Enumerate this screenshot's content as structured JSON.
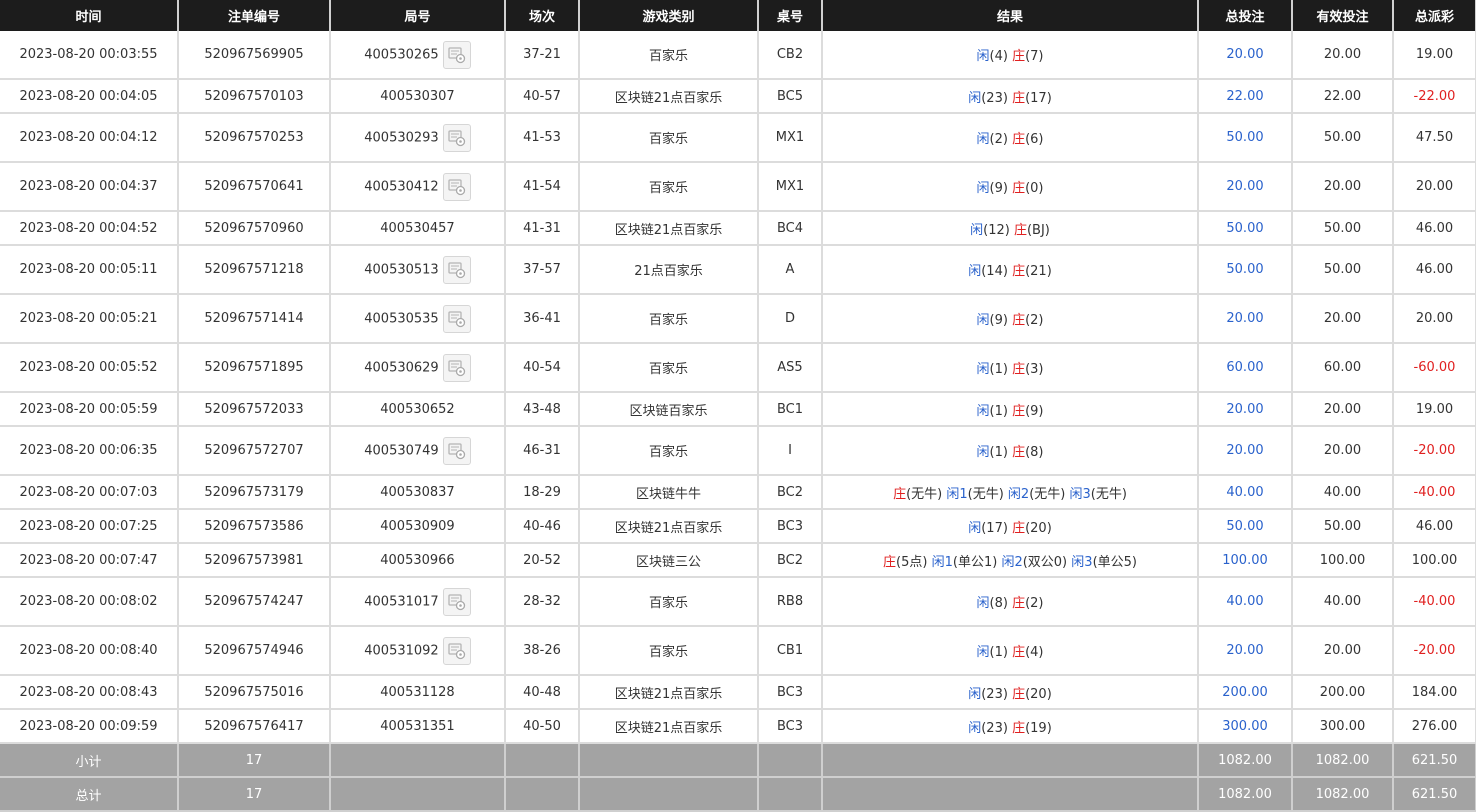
{
  "headers": [
    "时间",
    "注单编号",
    "局号",
    "场次",
    "游戏类别",
    "桌号",
    "结果",
    "总投注",
    "有效投注",
    "总派彩"
  ],
  "colors": {
    "header_bg": "#1c1c1c",
    "footer_bg": "#a3a3a3",
    "blue": "#2a62cc",
    "red": "#e02020"
  },
  "rows": [
    {
      "time": "2023-08-20 00:03:55",
      "order": "520967569905",
      "round": "400530265",
      "has_icon": true,
      "session": "37-21",
      "game": "百家乐",
      "table": "CB2",
      "result": [
        {
          "t": "闲",
          "c": "x"
        },
        {
          "t": "(4) ",
          "c": "g"
        },
        {
          "t": "庄",
          "c": "z"
        },
        {
          "t": "(7)",
          "c": "g"
        }
      ],
      "bet": "20.00",
      "valid": "20.00",
      "payout": "19.00",
      "neg": false
    },
    {
      "time": "2023-08-20 00:04:05",
      "order": "520967570103",
      "round": "400530307",
      "has_icon": false,
      "session": "40-57",
      "game": "区块链21点百家乐",
      "table": "BC5",
      "result": [
        {
          "t": "闲",
          "c": "x"
        },
        {
          "t": "(23) ",
          "c": "g"
        },
        {
          "t": "庄",
          "c": "z"
        },
        {
          "t": "(17)",
          "c": "g"
        }
      ],
      "bet": "22.00",
      "valid": "22.00",
      "payout": "-22.00",
      "neg": true
    },
    {
      "time": "2023-08-20 00:04:12",
      "order": "520967570253",
      "round": "400530293",
      "has_icon": true,
      "session": "41-53",
      "game": "百家乐",
      "table": "MX1",
      "result": [
        {
          "t": "闲",
          "c": "x"
        },
        {
          "t": "(2) ",
          "c": "g"
        },
        {
          "t": "庄",
          "c": "z"
        },
        {
          "t": "(6)",
          "c": "g"
        }
      ],
      "bet": "50.00",
      "valid": "50.00",
      "payout": "47.50",
      "neg": false
    },
    {
      "time": "2023-08-20 00:04:37",
      "order": "520967570641",
      "round": "400530412",
      "has_icon": true,
      "session": "41-54",
      "game": "百家乐",
      "table": "MX1",
      "result": [
        {
          "t": "闲",
          "c": "x"
        },
        {
          "t": "(9) ",
          "c": "g"
        },
        {
          "t": "庄",
          "c": "z"
        },
        {
          "t": "(0)",
          "c": "g"
        }
      ],
      "bet": "20.00",
      "valid": "20.00",
      "payout": "20.00",
      "neg": false
    },
    {
      "time": "2023-08-20 00:04:52",
      "order": "520967570960",
      "round": "400530457",
      "has_icon": false,
      "session": "41-31",
      "game": "区块链21点百家乐",
      "table": "BC4",
      "result": [
        {
          "t": "闲",
          "c": "x"
        },
        {
          "t": "(12) ",
          "c": "g"
        },
        {
          "t": "庄",
          "c": "z"
        },
        {
          "t": "(BJ)",
          "c": "g"
        }
      ],
      "bet": "50.00",
      "valid": "50.00",
      "payout": "46.00",
      "neg": false
    },
    {
      "time": "2023-08-20 00:05:11",
      "order": "520967571218",
      "round": "400530513",
      "has_icon": true,
      "session": "37-57",
      "game": "21点百家乐",
      "table": "A",
      "result": [
        {
          "t": "闲",
          "c": "x"
        },
        {
          "t": "(14) ",
          "c": "g"
        },
        {
          "t": "庄",
          "c": "z"
        },
        {
          "t": "(21)",
          "c": "g"
        }
      ],
      "bet": "50.00",
      "valid": "50.00",
      "payout": "46.00",
      "neg": false
    },
    {
      "time": "2023-08-20 00:05:21",
      "order": "520967571414",
      "round": "400530535",
      "has_icon": true,
      "session": "36-41",
      "game": "百家乐",
      "table": "D",
      "result": [
        {
          "t": "闲",
          "c": "x"
        },
        {
          "t": "(9) ",
          "c": "g"
        },
        {
          "t": "庄",
          "c": "z"
        },
        {
          "t": "(2)",
          "c": "g"
        }
      ],
      "bet": "20.00",
      "valid": "20.00",
      "payout": "20.00",
      "neg": false
    },
    {
      "time": "2023-08-20 00:05:52",
      "order": "520967571895",
      "round": "400530629",
      "has_icon": true,
      "session": "40-54",
      "game": "百家乐",
      "table": "AS5",
      "result": [
        {
          "t": "闲",
          "c": "x"
        },
        {
          "t": "(1) ",
          "c": "g"
        },
        {
          "t": "庄",
          "c": "z"
        },
        {
          "t": "(3)",
          "c": "g"
        }
      ],
      "bet": "60.00",
      "valid": "60.00",
      "payout": "-60.00",
      "neg": true
    },
    {
      "time": "2023-08-20 00:05:59",
      "order": "520967572033",
      "round": "400530652",
      "has_icon": false,
      "session": "43-48",
      "game": "区块链百家乐",
      "table": "BC1",
      "result": [
        {
          "t": "闲",
          "c": "x"
        },
        {
          "t": "(1) ",
          "c": "g"
        },
        {
          "t": "庄",
          "c": "z"
        },
        {
          "t": "(9)",
          "c": "g"
        }
      ],
      "bet": "20.00",
      "valid": "20.00",
      "payout": "19.00",
      "neg": false
    },
    {
      "time": "2023-08-20 00:06:35",
      "order": "520967572707",
      "round": "400530749",
      "has_icon": true,
      "session": "46-31",
      "game": "百家乐",
      "table": "I",
      "result": [
        {
          "t": "闲",
          "c": "x"
        },
        {
          "t": "(1) ",
          "c": "g"
        },
        {
          "t": "庄",
          "c": "z"
        },
        {
          "t": "(8)",
          "c": "g"
        }
      ],
      "bet": "20.00",
      "valid": "20.00",
      "payout": "-20.00",
      "neg": true
    },
    {
      "time": "2023-08-20 00:07:03",
      "order": "520967573179",
      "round": "400530837",
      "has_icon": false,
      "session": "18-29",
      "game": "区块链牛牛",
      "table": "BC2",
      "result": [
        {
          "t": "庄",
          "c": "z"
        },
        {
          "t": "(无牛) ",
          "c": "g"
        },
        {
          "t": "闲1",
          "c": "x"
        },
        {
          "t": "(无牛) ",
          "c": "g"
        },
        {
          "t": "闲2",
          "c": "x"
        },
        {
          "t": "(无牛) ",
          "c": "g"
        },
        {
          "t": "闲3",
          "c": "x"
        },
        {
          "t": "(无牛)",
          "c": "g"
        }
      ],
      "bet": "40.00",
      "valid": "40.00",
      "payout": "-40.00",
      "neg": true
    },
    {
      "time": "2023-08-20 00:07:25",
      "order": "520967573586",
      "round": "400530909",
      "has_icon": false,
      "session": "40-46",
      "game": "区块链21点百家乐",
      "table": "BC3",
      "result": [
        {
          "t": "闲",
          "c": "x"
        },
        {
          "t": "(17) ",
          "c": "g"
        },
        {
          "t": "庄",
          "c": "z"
        },
        {
          "t": "(20)",
          "c": "g"
        }
      ],
      "bet": "50.00",
      "valid": "50.00",
      "payout": "46.00",
      "neg": false
    },
    {
      "time": "2023-08-20 00:07:47",
      "order": "520967573981",
      "round": "400530966",
      "has_icon": false,
      "session": "20-52",
      "game": "区块链三公",
      "table": "BC2",
      "result": [
        {
          "t": "庄",
          "c": "z"
        },
        {
          "t": "(5点) ",
          "c": "g"
        },
        {
          "t": "闲1",
          "c": "x"
        },
        {
          "t": "(单公1) ",
          "c": "g"
        },
        {
          "t": "闲2",
          "c": "x"
        },
        {
          "t": "(双公0) ",
          "c": "g"
        },
        {
          "t": "闲3",
          "c": "x"
        },
        {
          "t": "(单公5)",
          "c": "g"
        }
      ],
      "bet": "100.00",
      "valid": "100.00",
      "payout": "100.00",
      "neg": false
    },
    {
      "time": "2023-08-20 00:08:02",
      "order": "520967574247",
      "round": "400531017",
      "has_icon": true,
      "session": "28-32",
      "game": "百家乐",
      "table": "RB8",
      "result": [
        {
          "t": "闲",
          "c": "x"
        },
        {
          "t": "(8) ",
          "c": "g"
        },
        {
          "t": "庄",
          "c": "z"
        },
        {
          "t": "(2)",
          "c": "g"
        }
      ],
      "bet": "40.00",
      "valid": "40.00",
      "payout": "-40.00",
      "neg": true
    },
    {
      "time": "2023-08-20 00:08:40",
      "order": "520967574946",
      "round": "400531092",
      "has_icon": true,
      "session": "38-26",
      "game": "百家乐",
      "table": "CB1",
      "result": [
        {
          "t": "闲",
          "c": "x"
        },
        {
          "t": "(1) ",
          "c": "g"
        },
        {
          "t": "庄",
          "c": "z"
        },
        {
          "t": "(4)",
          "c": "g"
        }
      ],
      "bet": "20.00",
      "valid": "20.00",
      "payout": "-20.00",
      "neg": true
    },
    {
      "time": "2023-08-20 00:08:43",
      "order": "520967575016",
      "round": "400531128",
      "has_icon": false,
      "session": "40-48",
      "game": "区块链21点百家乐",
      "table": "BC3",
      "result": [
        {
          "t": "闲",
          "c": "x"
        },
        {
          "t": "(23) ",
          "c": "g"
        },
        {
          "t": "庄",
          "c": "z"
        },
        {
          "t": "(20)",
          "c": "g"
        }
      ],
      "bet": "200.00",
      "valid": "200.00",
      "payout": "184.00",
      "neg": false
    },
    {
      "time": "2023-08-20 00:09:59",
      "order": "520967576417",
      "round": "400531351",
      "has_icon": false,
      "session": "40-50",
      "game": "区块链21点百家乐",
      "table": "BC3",
      "result": [
        {
          "t": "闲",
          "c": "x"
        },
        {
          "t": "(23) ",
          "c": "g"
        },
        {
          "t": "庄",
          "c": "z"
        },
        {
          "t": "(19)",
          "c": "g"
        }
      ],
      "bet": "300.00",
      "valid": "300.00",
      "payout": "276.00",
      "neg": false
    }
  ],
  "subtotal": {
    "label": "小计",
    "count": "17",
    "bet": "1082.00",
    "valid": "1082.00",
    "payout": "621.50"
  },
  "total": {
    "label": "总计",
    "count": "17",
    "bet": "1082.00",
    "valid": "1082.00",
    "payout": "621.50"
  }
}
